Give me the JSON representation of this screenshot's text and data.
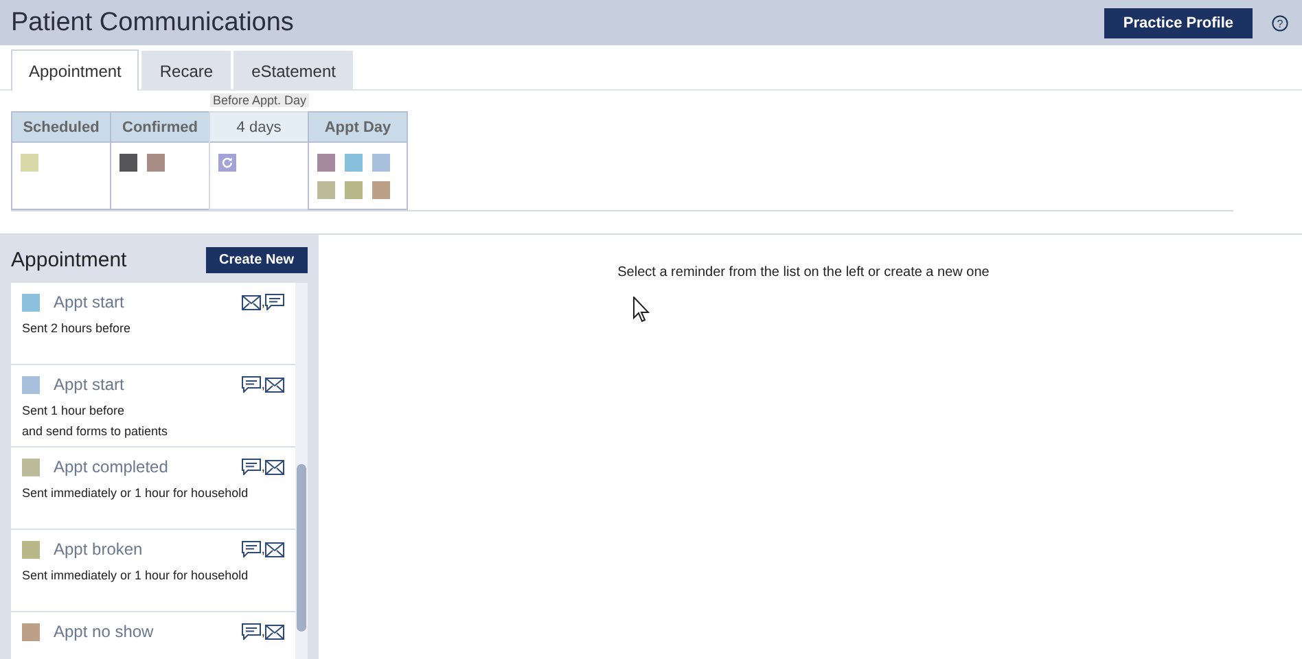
{
  "header": {
    "title": "Patient Communications",
    "profile_button": "Practice Profile",
    "help": "?"
  },
  "tabs": [
    {
      "label": "Appointment",
      "selected": true
    },
    {
      "label": "Recare",
      "selected": false
    },
    {
      "label": "eStatement",
      "selected": false
    }
  ],
  "stages": [
    {
      "label": "Scheduled",
      "selected": false,
      "swatches": [
        {
          "kind": "plain",
          "color": "#d8d8a8"
        }
      ]
    },
    {
      "label": "Confirmed",
      "selected": false,
      "swatches": [
        {
          "kind": "plain",
          "color": "#555558"
        },
        {
          "kind": "plain",
          "color": "#a88c86"
        }
      ]
    },
    {
      "label": "4 days",
      "caption": "Before Appt. Day",
      "selected": true,
      "swatches": [
        {
          "kind": "recurring",
          "color": "#a3a3d8"
        }
      ]
    },
    {
      "label": "Appt Day",
      "selected": false,
      "swatches": [
        {
          "kind": "plain",
          "color": "#a5879e"
        },
        {
          "kind": "plain",
          "color": "#86c0dc"
        },
        {
          "kind": "plain",
          "color": "#a8c0dc"
        },
        {
          "kind": "plain",
          "color": "#bcbc9a"
        },
        {
          "kind": "plain",
          "color": "#b8b888"
        },
        {
          "kind": "plain",
          "color": "#bca088"
        }
      ]
    }
  ],
  "list": {
    "title": "Appointment",
    "create_button": "Create New",
    "items": [
      {
        "title": "Appt start",
        "color": "#8cc0dc",
        "lines": [
          "Sent 2 hours before"
        ],
        "separator": ",",
        "channels": [
          {
            "kind": "email"
          },
          {
            "kind": "sms"
          }
        ]
      },
      {
        "title": "Appt start",
        "color": "#a8c0dc",
        "lines": [
          "Sent 1 hour before",
          "and send forms to patients"
        ],
        "separator": ",",
        "channels": [
          {
            "kind": "sms"
          },
          {
            "kind": "email"
          }
        ]
      },
      {
        "title": "Appt completed",
        "color": "#bcbc9a",
        "lines": [
          "Sent immediately or 1 hour for household"
        ],
        "separator": ",",
        "channels": [
          {
            "kind": "sms"
          },
          {
            "kind": "email"
          }
        ]
      },
      {
        "title": "Appt broken",
        "color": "#b8b888",
        "lines": [
          "Sent immediately or 1 hour for household"
        ],
        "separator": ",",
        "channels": [
          {
            "kind": "sms"
          },
          {
            "kind": "email"
          }
        ]
      },
      {
        "title": "Appt no show",
        "color": "#bca088",
        "separator": ",",
        "channels": [
          {
            "kind": "sms"
          },
          {
            "kind": "email"
          }
        ]
      }
    ]
  },
  "detail": {
    "message": "Select a reminder from the list on the left or create a new one"
  }
}
